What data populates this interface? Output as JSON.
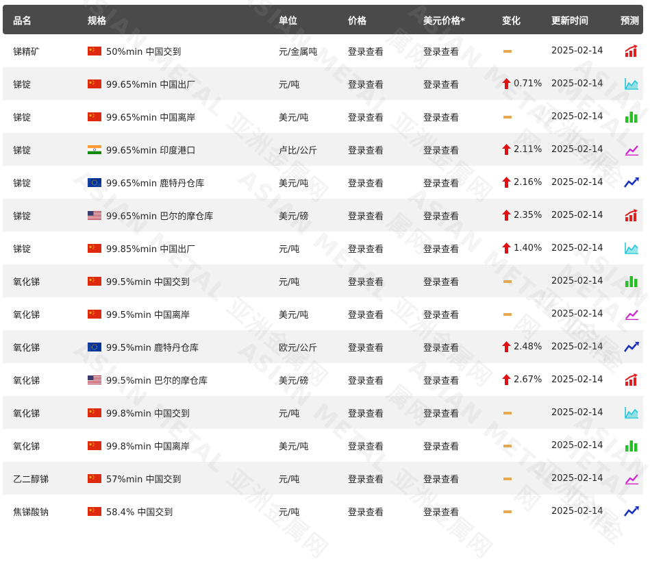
{
  "header": {
    "name": "品名",
    "spec": "规格",
    "unit": "单位",
    "price": "价格",
    "usd_price": "美元价格*",
    "change": "变化",
    "update_time": "更新时间",
    "forecast": "预测"
  },
  "rows": [
    {
      "name": "锑精矿",
      "flag": "cn",
      "spec": "50%min 中国交到",
      "unit": "元/金属吨",
      "price": "登录查看",
      "usd": "登录查看",
      "dir": "flat",
      "change": "",
      "date": "2025-02-14",
      "fc": "bar-up",
      "fc_color": "#e02020"
    },
    {
      "name": "锑锭",
      "flag": "cn",
      "spec": "99.65%min 中国出厂",
      "unit": "元/吨",
      "price": "登录查看",
      "usd": "登录查看",
      "dir": "up",
      "change": "0.71%",
      "date": "2025-02-14",
      "fc": "area",
      "fc_color": "#22c8d8"
    },
    {
      "name": "锑锭",
      "flag": "cn",
      "spec": "99.65%min 中国离岸",
      "unit": "美元/吨",
      "price": "登录查看",
      "usd": "登录查看",
      "dir": "flat",
      "change": "",
      "date": "2025-02-14",
      "fc": "bars",
      "fc_color": "#22c020"
    },
    {
      "name": "锑锭",
      "flag": "in",
      "spec": "99.65%min 印度港口",
      "unit": "卢比/公斤",
      "price": "登录查看",
      "usd": "登录查看",
      "dir": "up",
      "change": "2.11%",
      "date": "2025-02-14",
      "fc": "pencil",
      "fc_color": "#d020d0"
    },
    {
      "name": "锑锭",
      "flag": "eu",
      "spec": "99.65%min 鹿特丹仓库",
      "unit": "美元/吨",
      "price": "登录查看",
      "usd": "登录查看",
      "dir": "up",
      "change": "2.16%",
      "date": "2025-02-14",
      "fc": "line",
      "fc_color": "#1830c0"
    },
    {
      "name": "锑锭",
      "flag": "us",
      "spec": "99.65%min 巴尔的摩仓库",
      "unit": "美元/磅",
      "price": "登录查看",
      "usd": "登录查看",
      "dir": "up",
      "change": "2.35%",
      "date": "2025-02-14",
      "fc": "bar-up",
      "fc_color": "#e02020"
    },
    {
      "name": "锑锭",
      "flag": "cn",
      "spec": "99.85%min 中国出厂",
      "unit": "元/吨",
      "price": "登录查看",
      "usd": "登录查看",
      "dir": "up",
      "change": "1.40%",
      "date": "2025-02-14",
      "fc": "area",
      "fc_color": "#22c8d8"
    },
    {
      "name": "氧化锑",
      "flag": "cn",
      "spec": "99.5%min 中国交到",
      "unit": "元/吨",
      "price": "登录查看",
      "usd": "登录查看",
      "dir": "flat",
      "change": "",
      "date": "2025-02-14",
      "fc": "bars",
      "fc_color": "#22c020"
    },
    {
      "name": "氧化锑",
      "flag": "cn",
      "spec": "99.5%min 中国离岸",
      "unit": "美元/吨",
      "price": "登录查看",
      "usd": "登录查看",
      "dir": "flat",
      "change": "",
      "date": "2025-02-14",
      "fc": "pencil",
      "fc_color": "#d020d0"
    },
    {
      "name": "氧化锑",
      "flag": "eu",
      "spec": "99.5%min 鹿特丹仓库",
      "unit": "欧元/公斤",
      "price": "登录查看",
      "usd": "登录查看",
      "dir": "up",
      "change": "2.48%",
      "date": "2025-02-14",
      "fc": "line",
      "fc_color": "#1830c0"
    },
    {
      "name": "氧化锑",
      "flag": "us",
      "spec": "99.5%min 巴尔的摩仓库",
      "unit": "美元/磅",
      "price": "登录查看",
      "usd": "登录查看",
      "dir": "up",
      "change": "2.67%",
      "date": "2025-02-14",
      "fc": "bar-up",
      "fc_color": "#e02020"
    },
    {
      "name": "氧化锑",
      "flag": "cn",
      "spec": "99.8%min 中国交到",
      "unit": "元/吨",
      "price": "登录查看",
      "usd": "登录查看",
      "dir": "flat",
      "change": "",
      "date": "2025-02-14",
      "fc": "area",
      "fc_color": "#22c8d8"
    },
    {
      "name": "氧化锑",
      "flag": "cn",
      "spec": "99.8%min 中国离岸",
      "unit": "美元/吨",
      "price": "登录查看",
      "usd": "登录查看",
      "dir": "flat",
      "change": "",
      "date": "2025-02-14",
      "fc": "bars",
      "fc_color": "#22c020"
    },
    {
      "name": "乙二醇锑",
      "flag": "cn",
      "spec": "57%min 中国交到",
      "unit": "元/吨",
      "price": "登录查看",
      "usd": "登录查看",
      "dir": "flat",
      "change": "",
      "date": "2025-02-14",
      "fc": "pencil",
      "fc_color": "#d020d0"
    },
    {
      "name": "焦锑酸钠",
      "flag": "cn",
      "spec": "58.4% 中国交到",
      "unit": "元/吨",
      "price": "登录查看",
      "usd": "登录查看",
      "dir": "flat",
      "change": "",
      "date": "2025-02-14",
      "fc": "line",
      "fc_color": "#1830c0"
    }
  ],
  "colors": {
    "header_bg": "#4a4a4a",
    "alt_row": "#f2f2f2",
    "up_arrow": "#e01010",
    "flat_dash": "#e8a94a"
  },
  "watermark": "ASIAN METAL 亚洲金属网"
}
